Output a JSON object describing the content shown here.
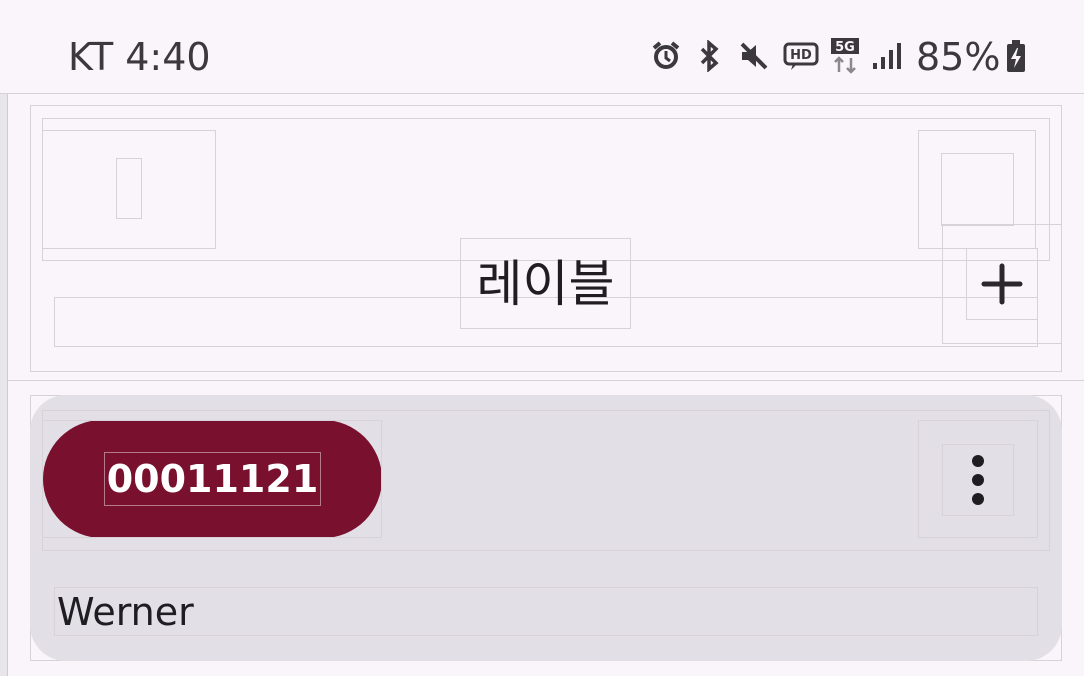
{
  "status_bar": {
    "carrier_time": "KT 4:40",
    "battery": "85%",
    "icons": [
      "alarm-icon",
      "bluetooth-icon",
      "mute-icon",
      "hd-voice-icon",
      "5g-icon",
      "signal-icon",
      "battery-charging-icon"
    ],
    "network_label": "5G",
    "hd_label": "HD"
  },
  "header": {
    "title": "레이블",
    "add_icon": "plus-icon"
  },
  "labels": [
    {
      "id": "00011121",
      "name": "Werner",
      "color": "#78102E",
      "menu_icon": "more-vertical-icon"
    }
  ]
}
